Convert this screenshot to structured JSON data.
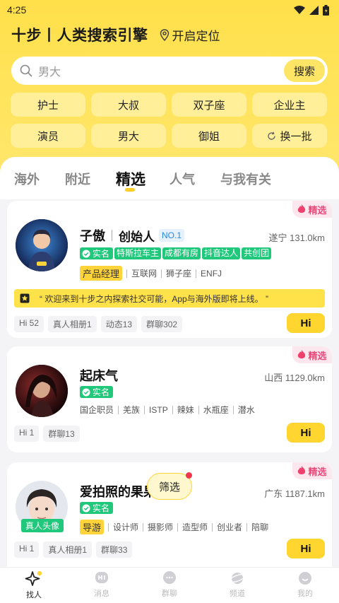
{
  "status_bar": {
    "time": "4:25"
  },
  "header": {
    "title": "十步丨人类搜索引擎",
    "location": "开启定位"
  },
  "search": {
    "placeholder": "男大",
    "button": "搜索"
  },
  "quick_tags": [
    "护士",
    "大叔",
    "双子座",
    "企业主",
    "演员",
    "男大",
    "御姐",
    "换一批"
  ],
  "tabs": [
    "海外",
    "附近",
    "精选",
    "人气",
    "与我有关"
  ],
  "cards": [
    {
      "badge": "精选",
      "name": "子傲",
      "role": "创始人",
      "rank": "NO.1",
      "distance": "遂宁 131.0km",
      "verified": "实名",
      "tags": [
        "特斯拉车主",
        "成都有房",
        "抖音达人",
        "共创团"
      ],
      "job": "产品经理",
      "info": [
        "互联网",
        "狮子座",
        "ENFJ"
      ],
      "announcement": "“ 欢迎来到十步之内探索社交可能，App与海外版即将上线。 ”",
      "stats": [
        "Hi 52",
        "真人相册1",
        "动态13",
        "群聊302"
      ],
      "hi": "Hi",
      "avatar_label": "十步"
    },
    {
      "badge": "精选",
      "name": "起床气",
      "distance": "山西 1129.0km",
      "verified": "实名",
      "info": [
        "国企职员",
        "羌族",
        "ISTP",
        "辣妹",
        "水瓶座",
        "潜水"
      ],
      "stats": [
        "Hi 1",
        "群聊13"
      ],
      "hi": "Hi"
    },
    {
      "badge": "精选",
      "name": "爱拍照的果果",
      "distance": "广东 1187.1km",
      "verified": "实名",
      "job": "导游",
      "info": [
        "设计师",
        "摄影师",
        "造型师",
        "创业者",
        "陪聊"
      ],
      "stats": [
        "Hi 1",
        "真人相册1",
        "群聊33"
      ],
      "hi": "Hi",
      "avatar_label": "真人头像"
    }
  ],
  "filter": {
    "label": "筛选"
  },
  "bottom_nav": [
    "找人",
    "消息",
    "群聊",
    "频道",
    "我的"
  ],
  "colors": {
    "accent": "#ffd52f",
    "verified": "#1fc87b",
    "pick": "#e84a7a"
  }
}
